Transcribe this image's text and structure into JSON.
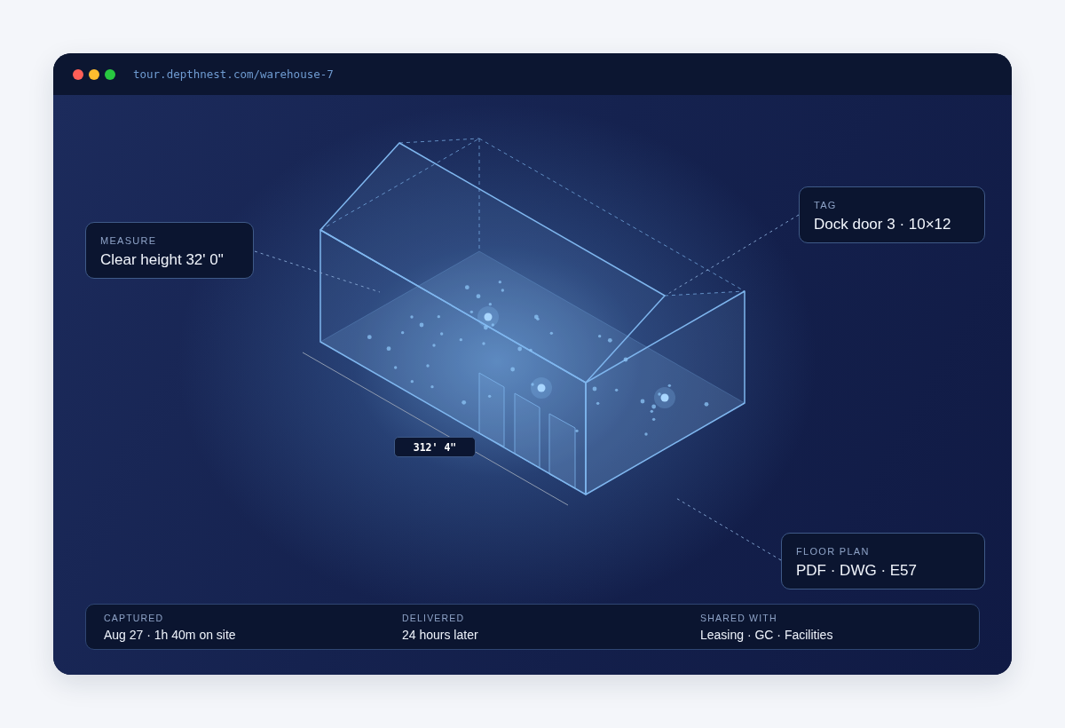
{
  "window": {
    "url": "tour.depthnest.com/warehouse-7"
  },
  "model": {
    "dimension_label": "312' 4\""
  },
  "callouts": [
    {
      "label": "MEASURE",
      "value": "Clear height 32' 0\""
    },
    {
      "label": "TAG",
      "value": "Dock door 3 · 10×12"
    },
    {
      "label": "FLOOR PLAN",
      "value": "PDF · DWG · E57"
    }
  ],
  "stats": [
    {
      "label": "CAPTURED",
      "value": "Aug 27 · 1h 40m on site"
    },
    {
      "label": "DELIVERED",
      "value": "24 hours later"
    },
    {
      "label": "SHARED WITH",
      "value": "Leasing · GC · Facilities"
    }
  ]
}
